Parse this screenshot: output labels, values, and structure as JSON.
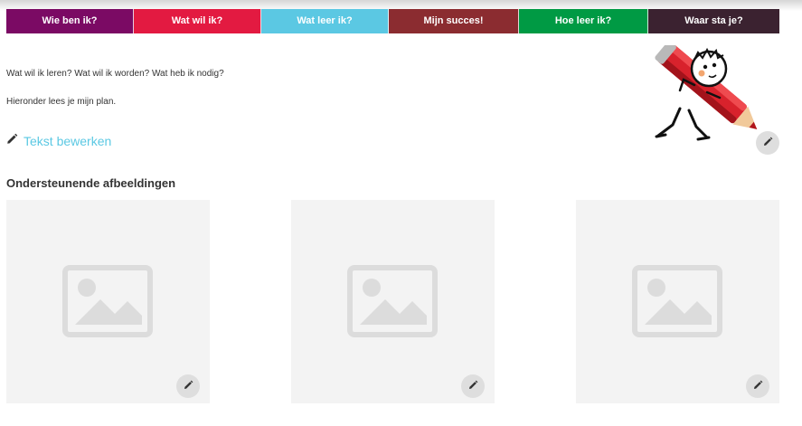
{
  "tabs": [
    {
      "label": "Wie ben ik?",
      "color": "#7b0a64"
    },
    {
      "label": "Wat wil ik?",
      "color": "#e31a41"
    },
    {
      "label": "Wat leer ik?",
      "color": "#5bc8e3"
    },
    {
      "label": "Mijn succes!",
      "color": "#8b2c30"
    },
    {
      "label": "Hoe leer ik?",
      "color": "#009a44"
    },
    {
      "label": "Waar sta je?",
      "color": "#3b2230"
    }
  ],
  "content": {
    "line1": "Wat wil ik leren? Wat wil ik worden? Wat heb ik nodig?",
    "line2": "Hieronder lees je mijn plan.",
    "edit_label": "Tekst bewerken",
    "section_heading": "Ondersteunende afbeeldingen"
  },
  "icons": {
    "edit": "pencil-icon",
    "placeholder": "image-placeholder-icon",
    "mascot": "pencil-character-illustration"
  },
  "colors": {
    "link": "#5bc8e3",
    "placeholder_bg": "#f3f3f3",
    "placeholder_icon": "#dcdcdc",
    "fab_bg": "#dedede"
  }
}
